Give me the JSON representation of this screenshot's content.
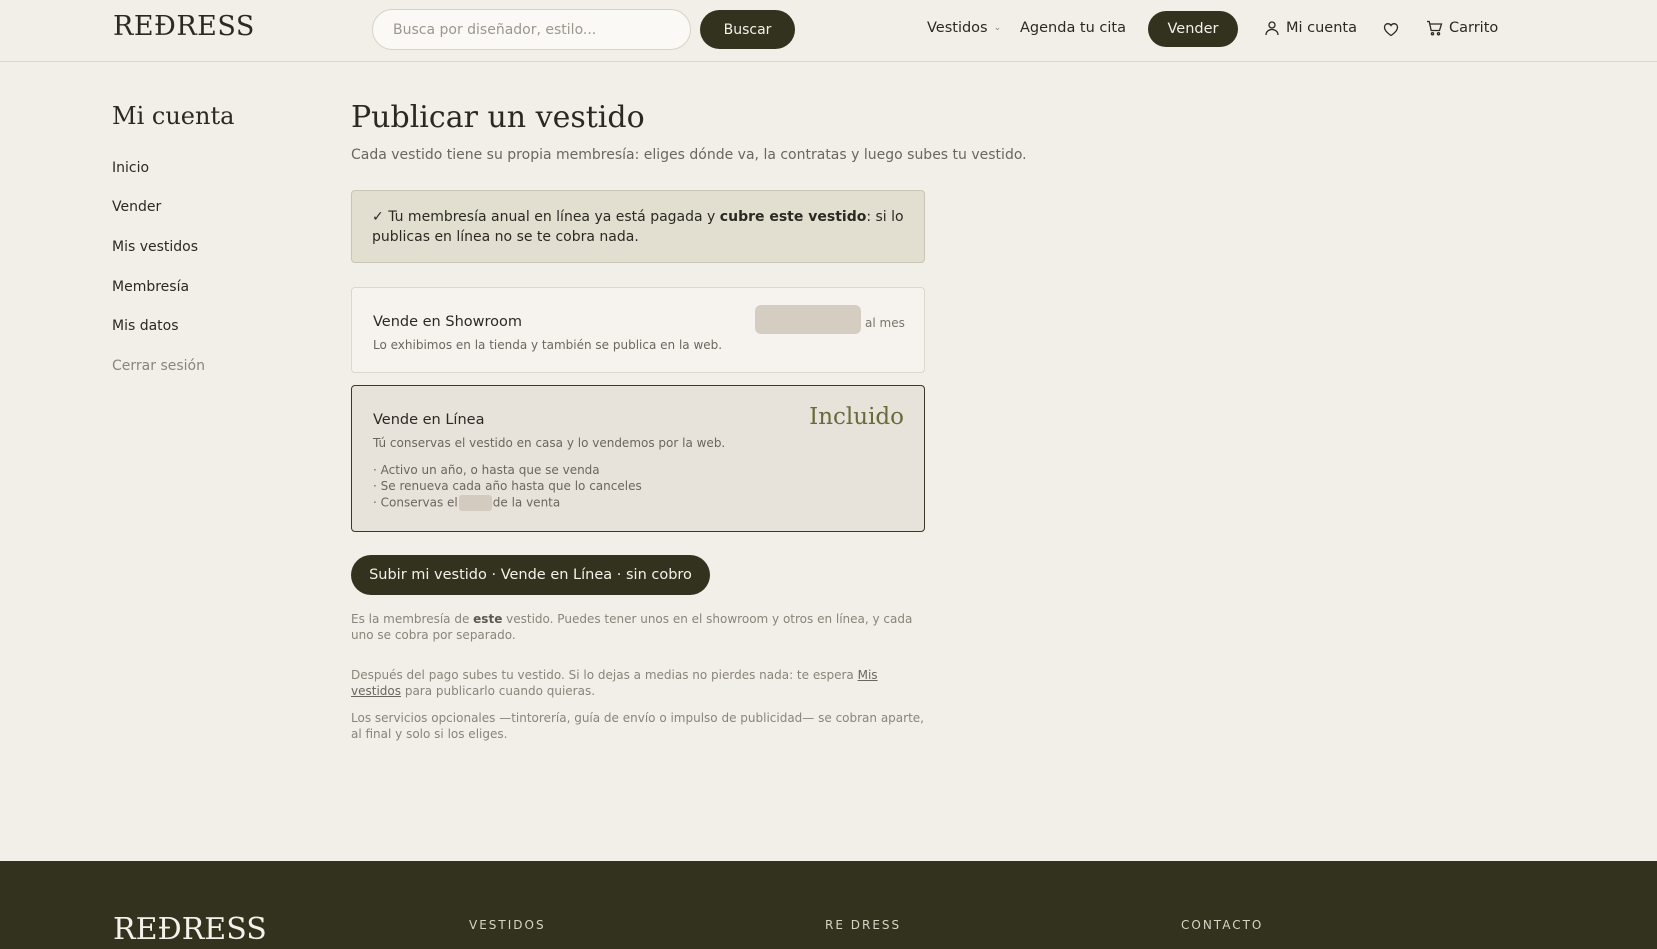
{
  "header": {
    "logo": "REÐRESS",
    "search_placeholder": "Busca por diseñador, estilo...",
    "search_button": "Buscar",
    "nav": {
      "vestidos": "Vestidos",
      "agenda": "Agenda tu cita",
      "vender": "Vender",
      "mi_cuenta": "Mi cuenta",
      "carrito": "Carrito"
    }
  },
  "sidebar": {
    "title": "Mi cuenta",
    "items": [
      {
        "label": "Inicio"
      },
      {
        "label": "Vender"
      },
      {
        "label": "Mis vestidos"
      },
      {
        "label": "Membresía"
      },
      {
        "label": "Mis datos"
      },
      {
        "label": "Cerrar sesión"
      }
    ]
  },
  "main": {
    "title": "Publicar un vestido",
    "subtitle": "Cada vestido tiene su propia membresía: eliges dónde va, la contratas y luego subes tu vestido.",
    "notice": {
      "check": "✓",
      "text_before": "Tu membresía anual en línea ya está pagada y",
      "bold": "cubre este vestido",
      "text_after": ": si lo publicas en línea no se te cobra nada."
    },
    "showroom": {
      "title": "Vende en Showroom",
      "desc": "Lo exhibimos en la tienda y también se publica en la web.",
      "per_month": "al mes"
    },
    "online": {
      "title": "Vende en Línea",
      "desc": "Tú conservas el vestido en casa y lo vendemos por la web.",
      "included": "Incluido",
      "features": [
        "· Activo un año, o hasta que se venda",
        "· Se renueva cada año hasta que lo canceles"
      ],
      "feature3_before": "· Conservas el",
      "feature3_after": "de la venta"
    },
    "cta": "Subir mi vestido · Vende en Línea · sin cobro",
    "note1_before": "Es la membresía de",
    "note1_bold": "este",
    "note1_after": "vestido. Puedes tener unos en el showroom y otros en línea, y cada uno se cobra por separado.",
    "note2_before": "Después del pago subes tu vestido. Si lo dejas a medias no pierdes nada: te espera",
    "note2_link": "Mis vestidos",
    "note2_after": "para publicarlo cuando quieras.",
    "note3": "Los servicios opcionales —tintorería, guía de envío o impulso de publicidad— se cobran aparte, al final y solo si los eliges."
  },
  "footer": {
    "logo": "REÐRESS",
    "headings": [
      "VESTIDOS",
      "RE DRESS",
      "CONTACTO"
    ]
  }
}
